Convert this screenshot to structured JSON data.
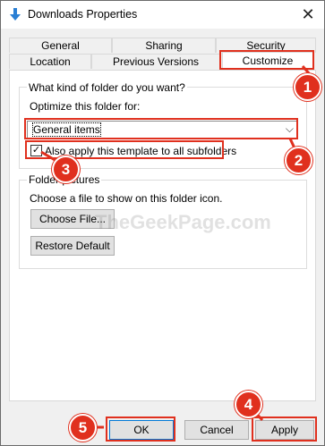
{
  "window": {
    "title": "Downloads Properties",
    "close_glyph": "✕"
  },
  "tabs": {
    "row1": [
      "General",
      "Sharing",
      "Security"
    ],
    "row2": [
      "Location",
      "Previous Versions",
      "Customize"
    ],
    "active": "Customize"
  },
  "folder_type": {
    "group_title": "What kind of folder do you want?",
    "optimize_label": "Optimize this folder for:",
    "selected_option": "General items",
    "arrow_glyph": "⌵",
    "apply_subfolders_label": "Also apply this template to all subfolders",
    "apply_subfolders_checked": true,
    "check_glyph": "✓"
  },
  "folder_pictures": {
    "group_title": "Folder pictures",
    "description": "Choose a file to show on this folder icon.",
    "choose_file_button": "Choose File...",
    "restore_default_button": "Restore Default"
  },
  "dialog_buttons": {
    "ok": "OK",
    "cancel": "Cancel",
    "apply": "Apply"
  },
  "annotations": {
    "badge_1": "1",
    "badge_2": "2",
    "badge_3": "3",
    "badge_4": "4",
    "badge_5": "5",
    "accent_color": "#e0301e"
  },
  "watermark": "TheGeekPage.com"
}
